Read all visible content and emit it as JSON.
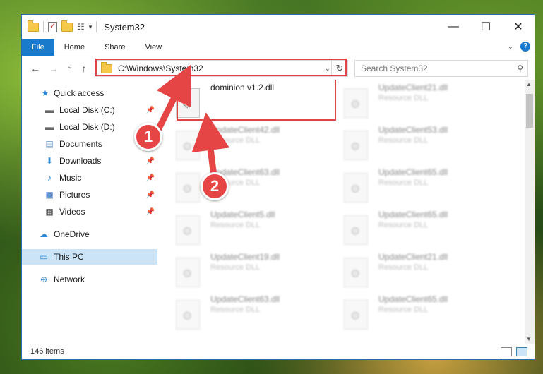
{
  "window": {
    "title": "System32",
    "controls": {
      "minimize": "—",
      "maximize": "☐",
      "close": "✕"
    }
  },
  "ribbon": {
    "tabs": [
      "File",
      "Home",
      "Share",
      "View"
    ],
    "expand_icon": "chevron-down-icon",
    "help_label": "?"
  },
  "nav": {
    "back": "←",
    "forward": "→",
    "recent": "⌄",
    "up": "↑"
  },
  "address": {
    "path": "C:\\Windows\\System32",
    "refresh": "↻",
    "dropdown": "⌄"
  },
  "search": {
    "placeholder": "Search System32"
  },
  "sidebar": {
    "items": [
      {
        "label": "Quick access",
        "icon": "star-icon",
        "pinned": false
      },
      {
        "label": "Local Disk (C:)",
        "icon": "drive-icon",
        "pinned": true
      },
      {
        "label": "Local Disk (D:)",
        "icon": "drive-icon",
        "pinned": false
      },
      {
        "label": "Documents",
        "icon": "document-icon",
        "pinned": false
      },
      {
        "label": "Downloads",
        "icon": "download-icon",
        "pinned": true
      },
      {
        "label": "Music",
        "icon": "music-icon",
        "pinned": true
      },
      {
        "label": "Pictures",
        "icon": "pictures-icon",
        "pinned": true
      },
      {
        "label": "Videos",
        "icon": "videos-icon",
        "pinned": true
      },
      {
        "label": "OneDrive",
        "icon": "cloud-icon",
        "pinned": false
      },
      {
        "label": "This PC",
        "icon": "computer-icon",
        "pinned": false,
        "selected": true
      },
      {
        "label": "Network",
        "icon": "network-icon",
        "pinned": false
      }
    ]
  },
  "files": {
    "highlighted": {
      "name": "dominion v1.2.dll",
      "type": ""
    },
    "left_column": [
      {
        "name": "UpdateClient42.dll",
        "type": "Resource DLL"
      },
      {
        "name": "UpdateClient63.dll",
        "type": "Resource DLL"
      },
      {
        "name": "UpdateClient5.dll",
        "type": "Resource DLL"
      },
      {
        "name": "UpdateClient19.dll",
        "type": "Resource DLL"
      },
      {
        "name": "UpdateClient63.dll",
        "type": "Resource DLL"
      }
    ],
    "right_column": [
      {
        "name": "UpdateClient21.dll",
        "type": "Resource DLL"
      },
      {
        "name": "UpdateClient53.dll",
        "type": "Resource DLL"
      },
      {
        "name": "UpdateClient65.dll",
        "type": "Resource DLL"
      },
      {
        "name": "UpdateClient65.dll",
        "type": "Resource DLL"
      },
      {
        "name": "UpdateClient21.dll",
        "type": "Resource DLL"
      },
      {
        "name": "UpdateClient65.dll",
        "type": "Resource DLL"
      }
    ]
  },
  "status": {
    "item_count": "146 items"
  },
  "callouts": {
    "one": "1",
    "two": "2"
  },
  "colors": {
    "accent": "#1979ca",
    "highlight": "#e04444",
    "selection": "#cce4f7"
  }
}
